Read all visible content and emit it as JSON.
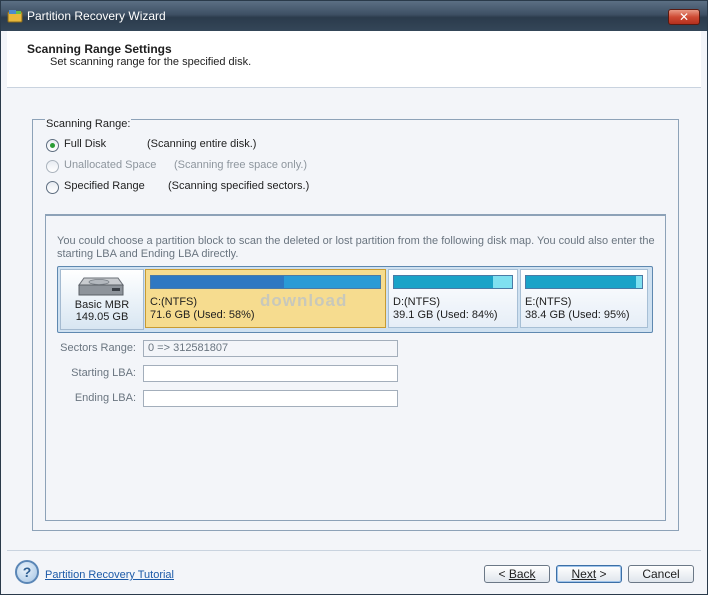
{
  "window": {
    "title": "Partition Recovery Wizard",
    "close_label": "✕"
  },
  "header": {
    "title": "Scanning Range Settings",
    "subtitle": "Set scanning range for the specified disk."
  },
  "scanning_range": {
    "label": "Scanning Range:",
    "options": [
      {
        "label": "Full Disk",
        "description": "(Scanning entire disk.)",
        "selected": true,
        "enabled": true
      },
      {
        "label": "Unallocated Space",
        "description": "(Scanning free space only.)",
        "selected": false,
        "enabled": false
      },
      {
        "label": "Specified Range",
        "description": "(Scanning specified sectors.)",
        "selected": false,
        "enabled": true
      }
    ]
  },
  "disk_map": {
    "info_text": "You could choose a partition block to scan the deleted or lost partition from the following disk map. You could also enter the starting LBA and Ending LBA directly.",
    "disk": {
      "type": "Basic MBR",
      "size": "149.05 GB",
      "icon": "hard-disk-icon"
    },
    "partitions": [
      {
        "name": "C:(NTFS)",
        "size_used": "71.6 GB (Used: 58%)",
        "used_fraction": 0.58,
        "selected": true,
        "fill_color": "#2e78c2",
        "rest_color": "#2a9bd6"
      },
      {
        "name": "D:(NTFS)",
        "size_used": "39.1 GB (Used: 84%)",
        "used_fraction": 0.84,
        "selected": false,
        "fill_color": "#1aa3c8",
        "rest_color": "#7fe0f0"
      },
      {
        "name": "E:(NTFS)",
        "size_used": "38.4 GB (Used: 95%)",
        "used_fraction": 0.95,
        "selected": false,
        "fill_color": "#1aa3c8",
        "rest_color": "#7fe0f0"
      }
    ],
    "watermark": "download"
  },
  "fields": {
    "sectors_range": {
      "label": "Sectors Range:",
      "value": "0 => 312581807"
    },
    "starting_lba": {
      "label": "Starting LBA:",
      "value": ""
    },
    "ending_lba": {
      "label": "Ending LBA:",
      "value": ""
    }
  },
  "footer": {
    "help_icon": "help-icon",
    "tutorial_link": "Partition Recovery Tutorial",
    "back_label": "Back",
    "next_label": "Next",
    "cancel_label": "Cancel"
  }
}
